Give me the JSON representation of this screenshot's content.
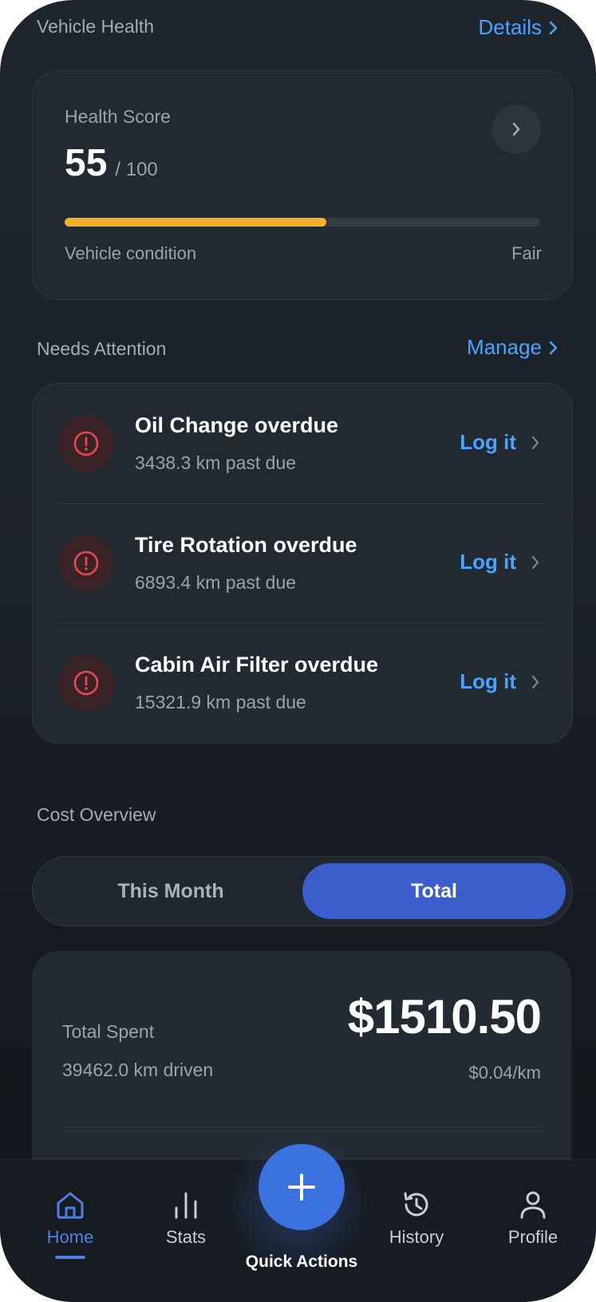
{
  "vehicle_health": {
    "section_title": "Vehicle Health",
    "details_link": "Details",
    "score_label": "Health Score",
    "score_value": "55",
    "score_max": "/ 100",
    "progress": 0.55,
    "condition_label": "Vehicle condition",
    "condition_value": "Fair",
    "bar_color": "#f6b12b"
  },
  "needs_attention": {
    "section_title": "Needs Attention",
    "manage_link": "Manage",
    "action_label": "Log it",
    "items": [
      {
        "title": "Oil Change overdue",
        "subtitle": "3438.3 km past due"
      },
      {
        "title": "Tire Rotation overdue",
        "subtitle": "6893.4 km past due"
      },
      {
        "title": "Cabin Air Filter overdue",
        "subtitle": "15321.9 km past due"
      }
    ]
  },
  "cost_overview": {
    "section_title": "Cost Overview",
    "segments": [
      "This Month",
      "Total"
    ],
    "selected_segment": "Total",
    "total_spent_label": "Total Spent",
    "total_spent_value": "$1510.50",
    "km_driven": "39462.0 km driven",
    "cost_per_km": "$0.04/km"
  },
  "bottom_nav": {
    "items": [
      {
        "label": "Home",
        "icon": "home-icon",
        "active": true
      },
      {
        "label": "Stats",
        "icon": "stats-icon",
        "active": false
      },
      {
        "label": "Quick Actions",
        "icon": "plus-icon",
        "active": false
      },
      {
        "label": "History",
        "icon": "history-icon",
        "active": false
      },
      {
        "label": "Profile",
        "icon": "profile-icon",
        "active": false
      }
    ],
    "accent_color": "#3b72e0"
  }
}
